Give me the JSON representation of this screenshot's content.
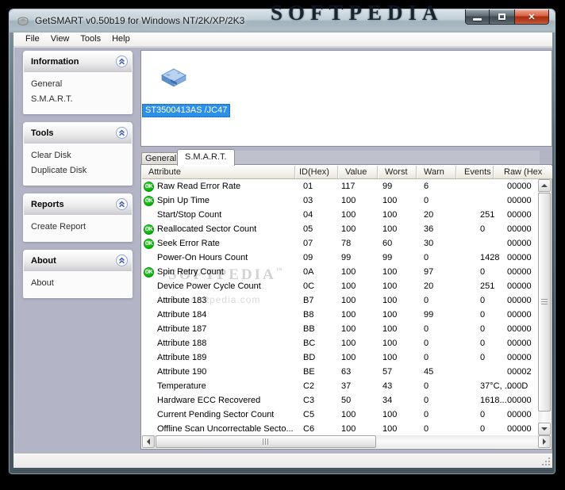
{
  "window": {
    "title": "GetSMART v0.50b19 for Windows NT/2K/XP/2K3"
  },
  "icons": {
    "close-icon": "✕",
    "minimize-icon": "minimize-bar",
    "maximize-icon": "maximize-square",
    "collapse-chevron-icon": "double-up-chevron",
    "app-icon": "disk-drive",
    "hard-disk-icon": "blue-hard-disk",
    "ok-status-icon": "green-circle-ok"
  },
  "watermarks": {
    "top": "SOFTPEDIA",
    "panel_title": "SOFTPEDIA",
    "panel_tm": "™",
    "panel_url": "www.softpedia.com"
  },
  "menu": {
    "items": [
      "File",
      "View",
      "Tools",
      "Help"
    ]
  },
  "sidebar": {
    "sections": [
      {
        "title": "Information",
        "items": [
          "General",
          "S.M.A.R.T."
        ]
      },
      {
        "title": "Tools",
        "items": [
          "Clear Disk",
          "Duplicate Disk"
        ]
      },
      {
        "title": "Reports",
        "items": [
          "Create Report"
        ]
      },
      {
        "title": "About",
        "items": [
          "About"
        ]
      }
    ]
  },
  "device_list": {
    "selected_device": "ST3500413AS /JC47"
  },
  "tabs": {
    "general": "General",
    "smart": "S.M.A.R.T."
  },
  "smart_table": {
    "ok_label": "OK",
    "columns": [
      "Attribute",
      "ID(Hex)",
      "Value",
      "Worst",
      "Warn",
      "Events",
      "Raw (Hex"
    ],
    "rows": [
      {
        "ok": true,
        "attribute": "Raw Read Error Rate",
        "id": "01",
        "value": "117",
        "worst": "99",
        "warn": "6",
        "events": "",
        "raw": "00000"
      },
      {
        "ok": true,
        "attribute": "Spin Up Time",
        "id": "03",
        "value": "100",
        "worst": "100",
        "warn": "0",
        "events": "",
        "raw": "00000"
      },
      {
        "ok": false,
        "attribute": "Start/Stop Count",
        "id": "04",
        "value": "100",
        "worst": "100",
        "warn": "20",
        "events": "251",
        "raw": "00000"
      },
      {
        "ok": true,
        "attribute": "Reallocated Sector Count",
        "id": "05",
        "value": "100",
        "worst": "100",
        "warn": "36",
        "events": "0",
        "raw": "00000"
      },
      {
        "ok": true,
        "attribute": "Seek Error Rate",
        "id": "07",
        "value": "78",
        "worst": "60",
        "warn": "30",
        "events": "",
        "raw": "00000"
      },
      {
        "ok": false,
        "attribute": "Power-On Hours Count",
        "id": "09",
        "value": "99",
        "worst": "99",
        "warn": "0",
        "events": "1428",
        "raw": "00000"
      },
      {
        "ok": true,
        "attribute": "Spin Retry Count",
        "id": "0A",
        "value": "100",
        "worst": "100",
        "warn": "97",
        "events": "0",
        "raw": "00000"
      },
      {
        "ok": false,
        "attribute": "Device Power Cycle Count",
        "id": "0C",
        "value": "100",
        "worst": "100",
        "warn": "20",
        "events": "251",
        "raw": "00000"
      },
      {
        "ok": false,
        "attribute": "Attribute 183",
        "id": "B7",
        "value": "100",
        "worst": "100",
        "warn": "0",
        "events": "0",
        "raw": "00000"
      },
      {
        "ok": false,
        "attribute": "Attribute 184",
        "id": "B8",
        "value": "100",
        "worst": "100",
        "warn": "99",
        "events": "0",
        "raw": "00000"
      },
      {
        "ok": false,
        "attribute": "Attribute 187",
        "id": "BB",
        "value": "100",
        "worst": "100",
        "warn": "0",
        "events": "0",
        "raw": "00000"
      },
      {
        "ok": false,
        "attribute": "Attribute 188",
        "id": "BC",
        "value": "100",
        "worst": "100",
        "warn": "0",
        "events": "0",
        "raw": "00000"
      },
      {
        "ok": false,
        "attribute": "Attribute 189",
        "id": "BD",
        "value": "100",
        "worst": "100",
        "warn": "0",
        "events": "0",
        "raw": "00000"
      },
      {
        "ok": false,
        "attribute": "Attribute 190",
        "id": "BE",
        "value": "63",
        "worst": "57",
        "warn": "45",
        "events": "",
        "raw": "00002"
      },
      {
        "ok": false,
        "attribute": "Temperature",
        "id": "C2",
        "value": "37",
        "worst": "43",
        "warn": "0",
        "events": "37°C, ...",
        "raw": "000D"
      },
      {
        "ok": false,
        "attribute": "Hardware ECC Recovered",
        "id": "C3",
        "value": "50",
        "worst": "34",
        "warn": "0",
        "events": "1618...",
        "raw": "00000"
      },
      {
        "ok": false,
        "attribute": "Current Pending Sector Count",
        "id": "C5",
        "value": "100",
        "worst": "100",
        "warn": "0",
        "events": "0",
        "raw": "00000"
      },
      {
        "ok": false,
        "attribute": "Offline Scan Uncorrectable Secto...",
        "id": "C6",
        "value": "100",
        "worst": "100",
        "warn": "0",
        "events": "0",
        "raw": "00000"
      }
    ]
  },
  "colors": {
    "selection_blue": "#2D90E8",
    "ok_green": "#0DBE0D",
    "client_background": "#B3B5C6",
    "close_button_red": "#C2532F"
  }
}
